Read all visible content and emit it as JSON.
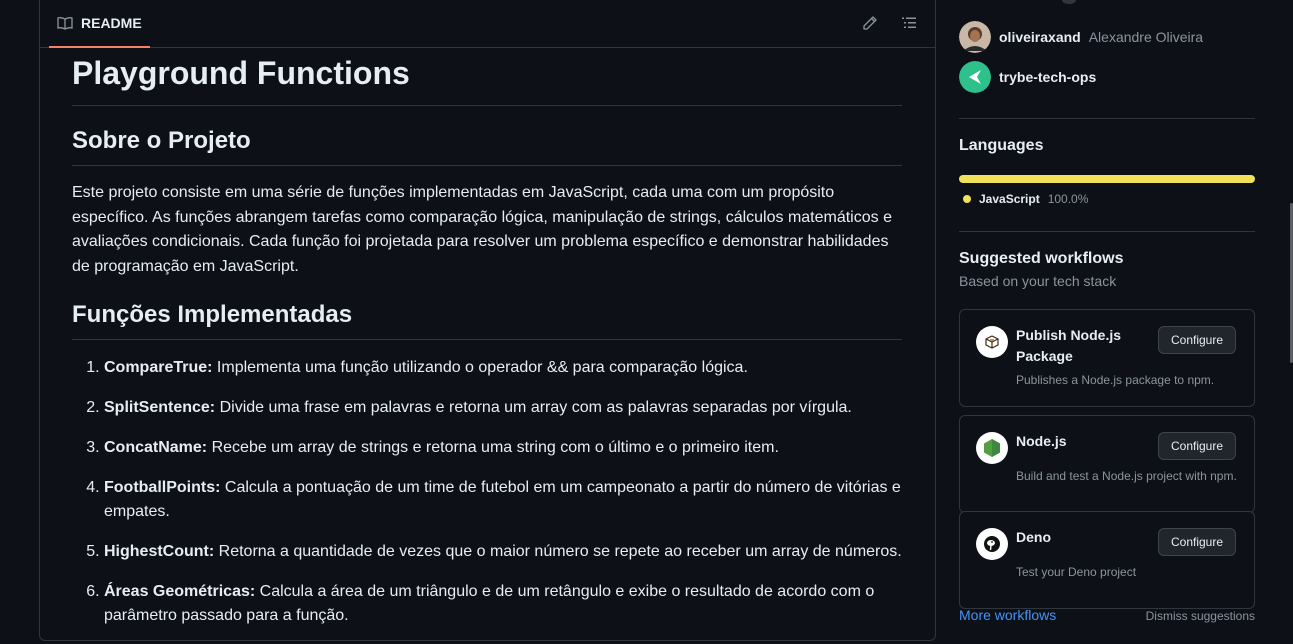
{
  "readme": {
    "tab_label": "README",
    "h1": "Playground Functions",
    "h2_about": "Sobre o Projeto",
    "about_text": "Este projeto consiste em uma série de funções implementadas em JavaScript, cada uma com um propósito específico. As funções abrangem tarefas como comparação lógica, manipulação de strings, cálculos matemáticos e avaliações condicionais. Cada função foi projetada para resolver um problema específico e demonstrar habilidades de programação em JavaScript.",
    "h2_functions": "Funções Implementadas",
    "functions": [
      {
        "name": "CompareTrue:",
        "desc": " Implementa uma função utilizando o operador && para comparação lógica."
      },
      {
        "name": "SplitSentence:",
        "desc": " Divide uma frase em palavras e retorna um array com as palavras separadas por vírgula."
      },
      {
        "name": "ConcatName:",
        "desc": " Recebe um array de strings e retorna uma string com o último e o primeiro item."
      },
      {
        "name": "FootballPoints:",
        "desc": " Calcula a pontuação de um time de futebol em um campeonato a partir do número de vitórias e empates."
      },
      {
        "name": "HighestCount:",
        "desc": " Retorna a quantidade de vezes que o maior número se repete ao receber um array de números."
      },
      {
        "name": "Áreas Geométricas:",
        "desc": " Calcula a área de um triângulo e de um retângulo e exibe o resultado de acordo com o parâmetro passado para a função."
      }
    ]
  },
  "sidebar": {
    "contributors": [
      {
        "login": "oliveiraxand",
        "name": "Alexandre Oliveira"
      },
      {
        "login": "trybe-tech-ops",
        "name": ""
      }
    ],
    "languages_heading": "Languages",
    "language": {
      "name": "JavaScript",
      "percent": "100.0%",
      "color": "#f1e05a",
      "share": 1.0
    },
    "workflows_heading": "Suggested workflows",
    "workflows_sub": "Based on your tech stack",
    "workflows": [
      {
        "title": "Publish Node.js Package",
        "desc": "Publishes a Node.js package to npm.",
        "button": "Configure",
        "icon": "package-icon"
      },
      {
        "title": "Node.js",
        "desc": "Build and test a Node.js project with npm.",
        "button": "Configure",
        "icon": "nodejs-icon"
      },
      {
        "title": "Deno",
        "desc": "Test your Deno project",
        "button": "Configure",
        "icon": "deno-icon"
      }
    ],
    "more_workflows": "More workflows",
    "dismiss": "Dismiss suggestions"
  },
  "colors": {
    "accent_tab": "#f78166",
    "link": "#4493f8",
    "trybe": "#2fc18c"
  }
}
